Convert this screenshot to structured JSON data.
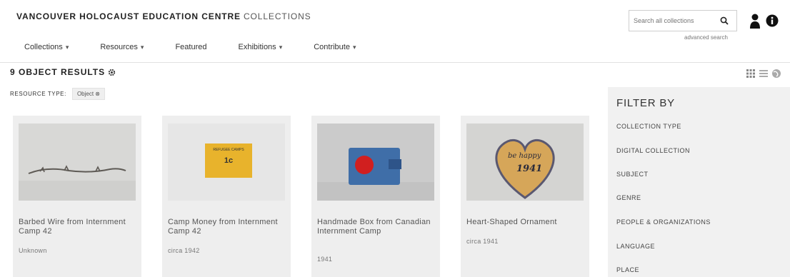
{
  "header": {
    "org": "VANCOUVER HOLOCAUST EDUCATION CENTRE",
    "section": "COLLECTIONS",
    "search_placeholder": "Search all collections",
    "advanced_search": "advanced search",
    "nav": [
      {
        "label": "Collections",
        "dropdown": true
      },
      {
        "label": "Resources",
        "dropdown": true
      },
      {
        "label": "Featured",
        "dropdown": false
      },
      {
        "label": "Exhibitions",
        "dropdown": true
      },
      {
        "label": "Contribute",
        "dropdown": true
      }
    ]
  },
  "results": {
    "heading": "9 OBJECT RESULTS",
    "resource_type_label": "RESOURCE TYPE:",
    "resource_type_chip": "Object"
  },
  "cards": [
    {
      "title": "Barbed Wire from Internment Camp 42",
      "date": "Unknown"
    },
    {
      "title": "Camp Money from Internment Camp 42",
      "date": "circa 1942",
      "money_text": "REFUGEE CAMPS",
      "money_sub": "1c"
    },
    {
      "title": "Handmade Box from Canadian Internment Camp",
      "date": "1941"
    },
    {
      "title": "Heart-Shaped Ornament",
      "date": "circa 1941",
      "heart_text": "be happy",
      "heart_year": "1941"
    }
  ],
  "filter": {
    "heading": "FILTER BY",
    "items": [
      "COLLECTION TYPE",
      "DIGITAL COLLECTION",
      "SUBJECT",
      "GENRE",
      "PEOPLE & ORGANIZATIONS",
      "LANGUAGE",
      "PLACE"
    ]
  },
  "colors": {
    "card_bg": "#eeeeee",
    "sidebar_bg": "#f1f1f1",
    "money_yellow": "#e8b32c",
    "box_blue": "#3f6ea8",
    "box_red": "#d11f1f"
  }
}
